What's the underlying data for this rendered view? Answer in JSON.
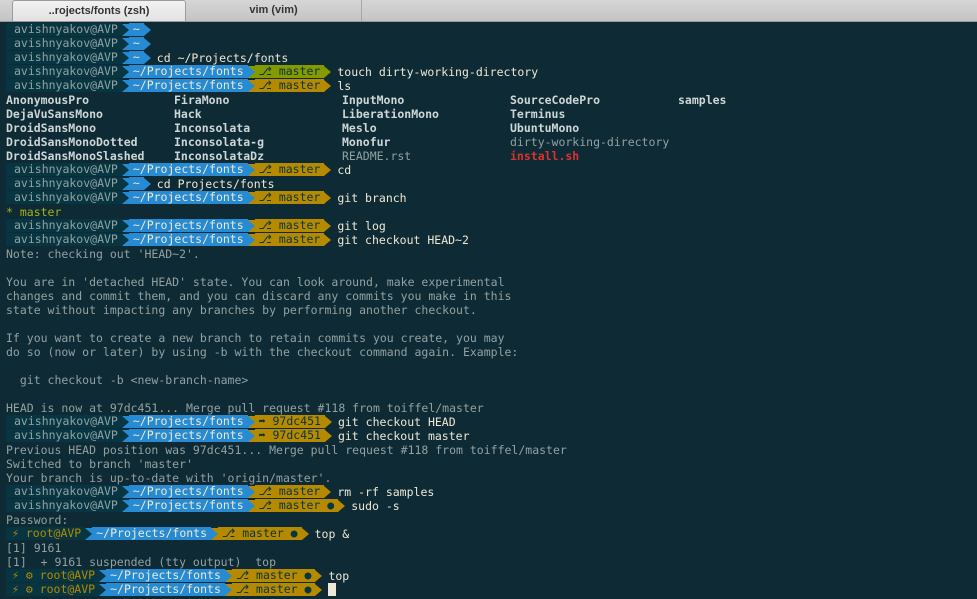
{
  "tabs": [
    {
      "label": "..rojects/fonts (zsh)",
      "active": true
    },
    {
      "label": "vim (vim)",
      "active": false
    }
  ],
  "colors": {
    "background": "#0d2a35",
    "user_segment": "#073642",
    "path_segment": "#268bd2",
    "git_clean": "#859900",
    "git_dirty": "#b58900",
    "error_red": "#dc322f"
  },
  "terminal": {
    "user": "avishnyakov@AVP",
    "root_user": "root@AVP",
    "home": "~",
    "path": "~/Projects/fonts",
    "branch_symbol": "⎇",
    "branch": "master",
    "detached_symbol": "➦",
    "commit": "97dc451",
    "dirty_marker": "●",
    "bolt": "⚡",
    "gear": "⚙",
    "lines": [
      {
        "kind": "prompt",
        "segments": [
          [
            "user",
            "avishnyakov@AVP"
          ],
          [
            "path",
            "~"
          ]
        ],
        "cmd": ""
      },
      {
        "kind": "prompt",
        "segments": [
          [
            "user",
            "avishnyakov@AVP"
          ],
          [
            "path",
            "~"
          ]
        ],
        "cmd": ""
      },
      {
        "kind": "prompt",
        "segments": [
          [
            "user",
            "avishnyakov@AVP"
          ],
          [
            "path",
            "~"
          ]
        ],
        "cmd": "cd ~/Projects/fonts"
      },
      {
        "kind": "prompt",
        "segments": [
          [
            "user",
            "avishnyakov@AVP"
          ],
          [
            "path",
            "~/Projects/fonts"
          ],
          [
            "clean",
            "⎇ master"
          ]
        ],
        "cmd": "touch dirty-working-directory"
      },
      {
        "kind": "prompt",
        "segments": [
          [
            "user",
            "avishnyakov@AVP"
          ],
          [
            "path",
            "~/Projects/fonts"
          ],
          [
            "dirty",
            "⎇ master"
          ]
        ],
        "cmd": "ls"
      },
      {
        "kind": "ls",
        "cols": [
          [
            "AnonymousPro",
            "bold"
          ],
          [
            "FiraMono",
            "bold"
          ],
          [
            "InputMono",
            "bold"
          ],
          [
            "SourceCodePro",
            "bold"
          ],
          [
            "samples",
            "bold"
          ]
        ]
      },
      {
        "kind": "ls",
        "cols": [
          [
            "DejaVuSansMono",
            "bold"
          ],
          [
            "Hack",
            "bold"
          ],
          [
            "LiberationMono",
            "bold"
          ],
          [
            "Terminus",
            "bold"
          ]
        ]
      },
      {
        "kind": "ls",
        "cols": [
          [
            "DroidSansMono",
            "bold"
          ],
          [
            "Inconsolata",
            "bold"
          ],
          [
            "Meslo",
            "bold"
          ],
          [
            "UbuntuMono",
            "bold"
          ]
        ]
      },
      {
        "kind": "ls",
        "cols": [
          [
            "DroidSansMonoDotted",
            "bold"
          ],
          [
            "Inconsolata-g",
            "bold"
          ],
          [
            "Monofur",
            "bold"
          ],
          [
            "dirty-working-directory",
            "out"
          ]
        ]
      },
      {
        "kind": "ls",
        "cols": [
          [
            "DroidSansMonoSlashed",
            "bold"
          ],
          [
            "InconsolataDz",
            "bold"
          ],
          [
            "README.rst",
            "out"
          ],
          [
            "install.sh",
            "red"
          ]
        ]
      },
      {
        "kind": "prompt",
        "segments": [
          [
            "user",
            "avishnyakov@AVP"
          ],
          [
            "path",
            "~/Projects/fonts"
          ],
          [
            "dirty",
            "⎇ master"
          ]
        ],
        "cmd": "cd"
      },
      {
        "kind": "prompt",
        "segments": [
          [
            "user",
            "avishnyakov@AVP"
          ],
          [
            "path",
            "~"
          ]
        ],
        "cmd": "cd Projects/fonts"
      },
      {
        "kind": "prompt",
        "segments": [
          [
            "user",
            "avishnyakov@AVP"
          ],
          [
            "path",
            "~/Projects/fonts"
          ],
          [
            "dirty",
            "⎇ master"
          ]
        ],
        "cmd": "git branch"
      },
      {
        "kind": "text",
        "text": "* master",
        "style": "greenish"
      },
      {
        "kind": "prompt",
        "segments": [
          [
            "user",
            "avishnyakov@AVP"
          ],
          [
            "path",
            "~/Projects/fonts"
          ],
          [
            "dirty",
            "⎇ master"
          ]
        ],
        "cmd": "git log"
      },
      {
        "kind": "prompt",
        "segments": [
          [
            "user",
            "avishnyakov@AVP"
          ],
          [
            "path",
            "~/Projects/fonts"
          ],
          [
            "dirty",
            "⎇ master"
          ]
        ],
        "cmd": "git checkout HEAD~2"
      },
      {
        "kind": "text",
        "text": "Note: checking out 'HEAD~2'."
      },
      {
        "kind": "text",
        "text": ""
      },
      {
        "kind": "text",
        "text": "You are in 'detached HEAD' state. You can look around, make experimental"
      },
      {
        "kind": "text",
        "text": "changes and commit them, and you can discard any commits you make in this"
      },
      {
        "kind": "text",
        "text": "state without impacting any branches by performing another checkout."
      },
      {
        "kind": "text",
        "text": ""
      },
      {
        "kind": "text",
        "text": "If you want to create a new branch to retain commits you create, you may"
      },
      {
        "kind": "text",
        "text": "do so (now or later) by using -b with the checkout command again. Example:"
      },
      {
        "kind": "text",
        "text": ""
      },
      {
        "kind": "text",
        "text": "  git checkout -b <new-branch-name>"
      },
      {
        "kind": "text",
        "text": ""
      },
      {
        "kind": "text",
        "text": "HEAD is now at 97dc451... Merge pull request #118 from toiffel/master"
      },
      {
        "kind": "prompt",
        "segments": [
          [
            "user",
            "avishnyakov@AVP"
          ],
          [
            "path",
            "~/Projects/fonts"
          ],
          [
            "dirty",
            "➦ 97dc451"
          ]
        ],
        "cmd": "git checkout HEAD"
      },
      {
        "kind": "prompt",
        "segments": [
          [
            "user",
            "avishnyakov@AVP"
          ],
          [
            "path",
            "~/Projects/fonts"
          ],
          [
            "dirty",
            "➦ 97dc451"
          ]
        ],
        "cmd": "git checkout master"
      },
      {
        "kind": "text",
        "text": "Previous HEAD position was 97dc451... Merge pull request #118 from toiffel/master"
      },
      {
        "kind": "text",
        "text": "Switched to branch 'master'"
      },
      {
        "kind": "text",
        "text": "Your branch is up-to-date with 'origin/master'."
      },
      {
        "kind": "prompt",
        "segments": [
          [
            "user",
            "avishnyakov@AVP"
          ],
          [
            "path",
            "~/Projects/fonts"
          ],
          [
            "dirty",
            "⎇ master"
          ]
        ],
        "cmd": "rm -rf samples"
      },
      {
        "kind": "prompt",
        "segments": [
          [
            "user",
            "avishnyakov@AVP"
          ],
          [
            "path",
            "~/Projects/fonts"
          ],
          [
            "dirty",
            "⎇ master ●"
          ]
        ],
        "cmd": "sudo -s"
      },
      {
        "kind": "text",
        "text": "Password:"
      },
      {
        "kind": "prompt",
        "segments": [
          [
            "root",
            "⚡ root@AVP"
          ],
          [
            "path",
            "~/Projects/fonts"
          ],
          [
            "dirty",
            "⎇ master ●"
          ]
        ],
        "cmd": "top &"
      },
      {
        "kind": "text",
        "text": "[1] 9161"
      },
      {
        "kind": "text",
        "text": "[1]  + 9161 suspended (tty output)  top"
      },
      {
        "kind": "prompt",
        "segments": [
          [
            "root",
            "⚡ ⚙ root@AVP"
          ],
          [
            "path",
            "~/Projects/fonts"
          ],
          [
            "dirty",
            "⎇ master ●"
          ]
        ],
        "cmd": "top"
      },
      {
        "kind": "prompt",
        "segments": [
          [
            "root",
            "⚡ ⚙ root@AVP"
          ],
          [
            "path",
            "~/Projects/fonts"
          ],
          [
            "dirty",
            "⎇ master ●"
          ]
        ],
        "cmd": "",
        "cursor": true
      }
    ]
  }
}
